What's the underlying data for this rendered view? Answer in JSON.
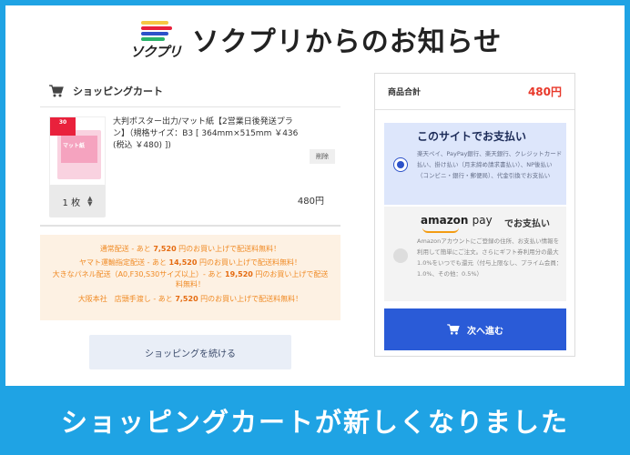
{
  "header": {
    "logo_text": "ソクプリ",
    "title": "ソクプリからのお知らせ"
  },
  "cart": {
    "heading": "ショッピングカート",
    "item": {
      "thumb_badge": "30",
      "thumb_tag": "マット紙",
      "name": "大判ポスター出力/マット紙【2営業日後発送プラン】（規格サイズ：B3 [ 364mm×515mm ￥436 (税込 ￥480) ])",
      "remove_label": "削除",
      "quantity": "1 枚",
      "price": "480円"
    },
    "notices": [
      {
        "pre": "通常配送 - あと ",
        "amount": "7,520",
        "post": " 円のお買い上げで配送料無料！"
      },
      {
        "pre": "ヤマト運輸指定配送 - あと ",
        "amount": "14,520",
        "post": " 円のお買い上げで配送料無料！"
      },
      {
        "pre": "大きなパネル配送（A0,F30,S30サイズ以上）- あと ",
        "amount": "19,520",
        "post": " 円のお買い上げで配送料無料！"
      },
      {
        "pre": "大阪本社　店頭手渡し - あと ",
        "amount": "7,520",
        "post": " 円のお買い上げで配送料無料！"
      }
    ],
    "continue_label": "ショッピングを続ける"
  },
  "summary": {
    "total_label": "商品合計",
    "total_value": "480円",
    "site_pay": {
      "title": "このサイトでお支払い",
      "desc": "楽天ペイ、PayPay銀行、楽天銀行、クレジットカード払い、掛け払い（月末締め請求書払い）、NP後払い（コンビニ・銀行・郵便局）、代金引換でお支払い"
    },
    "amazon_pay": {
      "brand_amazon": "amazon",
      "brand_pay": "pay",
      "suffix": "でお支払い",
      "desc": "Amazonアカウントにご登録の住所、お支払い情報を利用して簡単にご注文。さらにギフト券利用分の最大1.0%をいつでも還元（付与上限なし、プライム会員：1.0%、その他：0.5%）"
    },
    "next_label": "次へ進む"
  },
  "banner": {
    "text": "ショッピングカートが新しくなりました"
  },
  "colors": {
    "brand_blue": "#1fa3e4",
    "button_blue": "#2a5bd7",
    "price_red": "#e8382a",
    "notice_orange": "#f08a24"
  }
}
